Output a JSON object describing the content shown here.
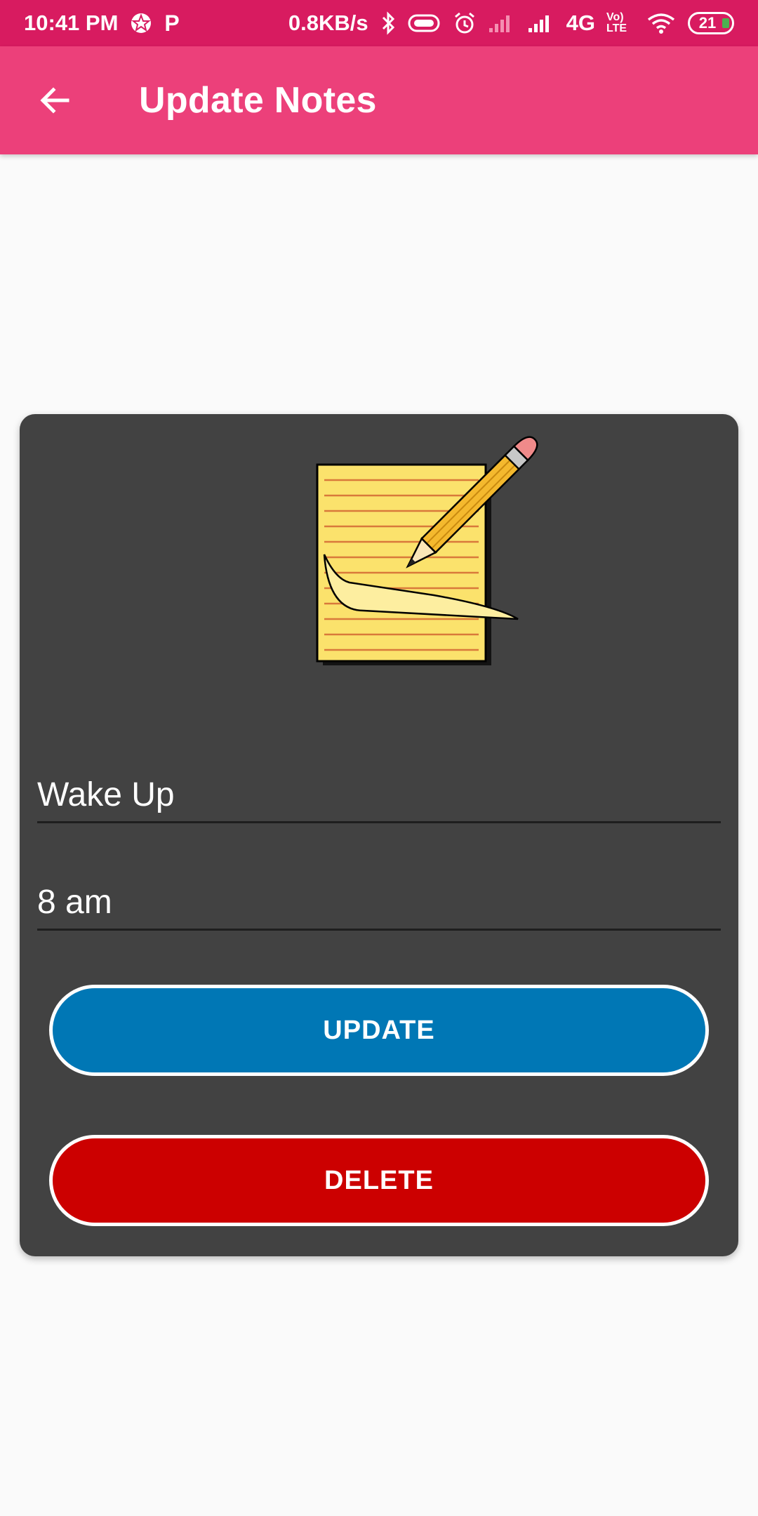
{
  "status_bar": {
    "time": "10:41 PM",
    "p_label": "P",
    "net_speed": "0.8KB/s",
    "network": "4G",
    "volte": "Vo) LTE",
    "battery": "21",
    "icons": [
      "vpn-icon",
      "bluetooth-icon",
      "battery-saver-icon",
      "alarm-icon",
      "signal-icon",
      "wifi-icon",
      "battery-icon"
    ]
  },
  "app_bar": {
    "back_icon": "arrow-left-icon",
    "title": "Update Notes",
    "color": "#ec407a"
  },
  "card": {
    "illustration": "notepad-pencil-icon",
    "title_value": "Wake Up",
    "time_value": "8 am",
    "update_label": "UPDATE",
    "delete_label": "DELETE",
    "update_color": "#0077b5",
    "delete_color": "#cc0000"
  }
}
